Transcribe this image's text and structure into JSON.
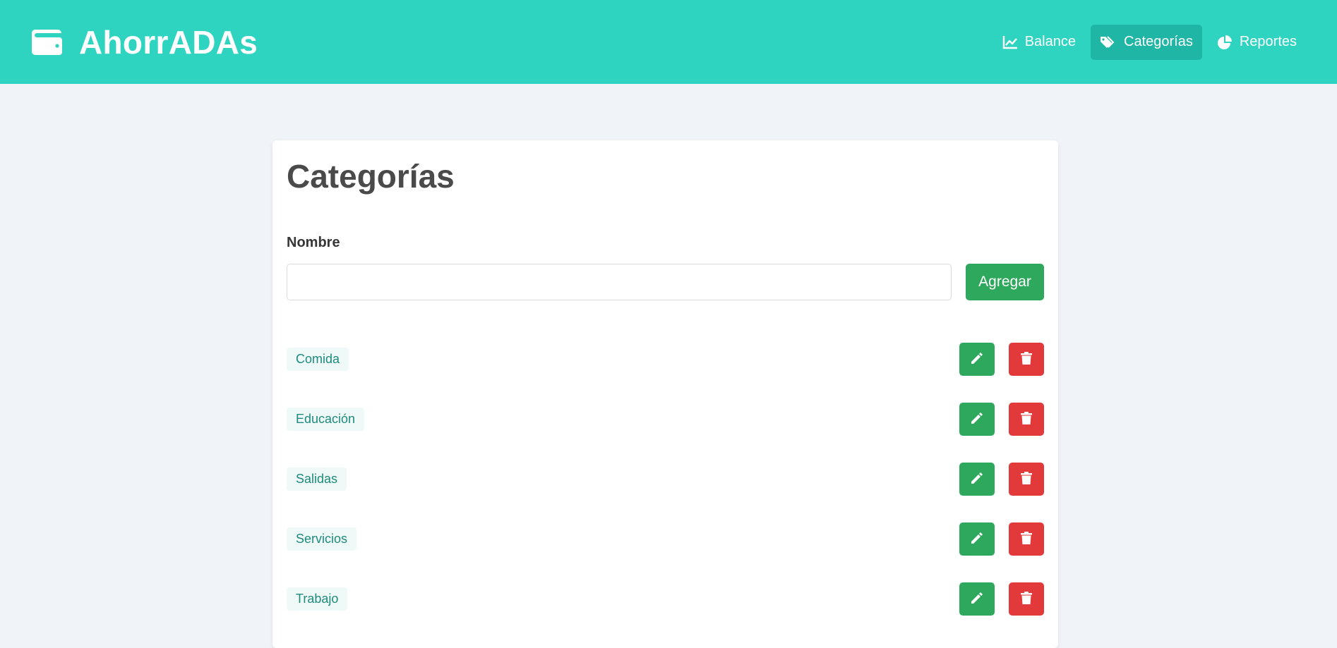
{
  "brand": {
    "name": "AhorrADAs",
    "icon": "wallet-icon"
  },
  "nav": [
    {
      "label": "Balance",
      "icon": "chart-line-icon",
      "active": false
    },
    {
      "label": "Categorías",
      "icon": "tags-icon",
      "active": true
    },
    {
      "label": "Reportes",
      "icon": "chart-pie-icon",
      "active": false
    }
  ],
  "page": {
    "title": "Categorías",
    "form": {
      "label": "Nombre",
      "input_value": "",
      "input_placeholder": "",
      "button_label": "Agregar"
    }
  },
  "categories": [
    {
      "name": "Comida"
    },
    {
      "name": "Educación"
    },
    {
      "name": "Salidas"
    },
    {
      "name": "Servicios"
    },
    {
      "name": "Trabajo"
    }
  ],
  "colors": {
    "primary": "#2fd4c1",
    "success": "#2ea85c",
    "danger": "#e23a3a",
    "background": "#f0f3f8"
  }
}
